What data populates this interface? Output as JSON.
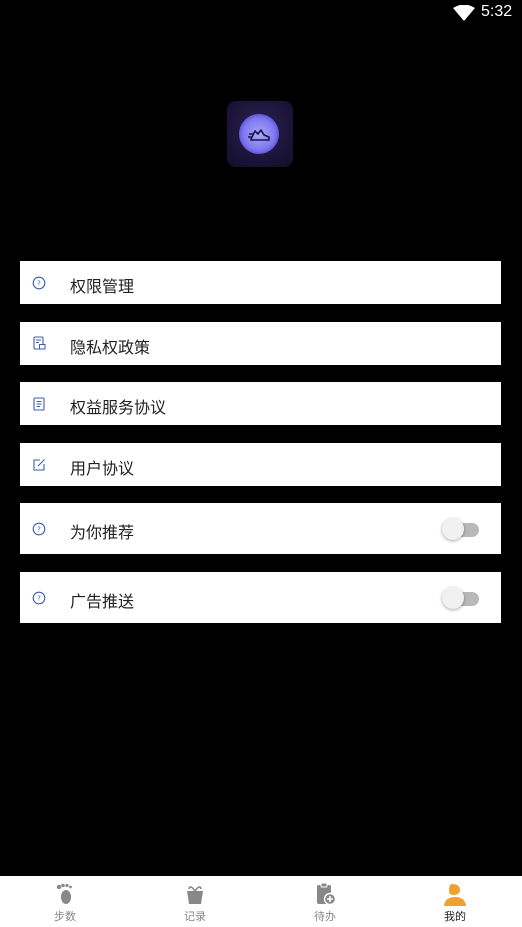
{
  "status": {
    "time": "5:32"
  },
  "menu": [
    {
      "label": "权限管理",
      "icon": "help-circle-icon"
    },
    {
      "label": "隐私权政策",
      "icon": "document-lock-icon"
    },
    {
      "label": "权益服务协议",
      "icon": "document-icon"
    },
    {
      "label": "用户协议",
      "icon": "edit-icon"
    },
    {
      "label": "为你推荐",
      "icon": "help-circle-icon",
      "toggle": false
    },
    {
      "label": "广告推送",
      "icon": "help-circle-icon",
      "toggle": false
    }
  ],
  "nav": [
    {
      "label": "步数",
      "icon": "footprint-icon"
    },
    {
      "label": "记录",
      "icon": "gift-icon"
    },
    {
      "label": "待办",
      "icon": "todo-icon"
    },
    {
      "label": "我的",
      "icon": "profile-icon",
      "active": true
    }
  ],
  "colors": {
    "accent": "#f0a030",
    "nav_inactive": "#888888",
    "icon_blue": "#3a5fb0"
  }
}
